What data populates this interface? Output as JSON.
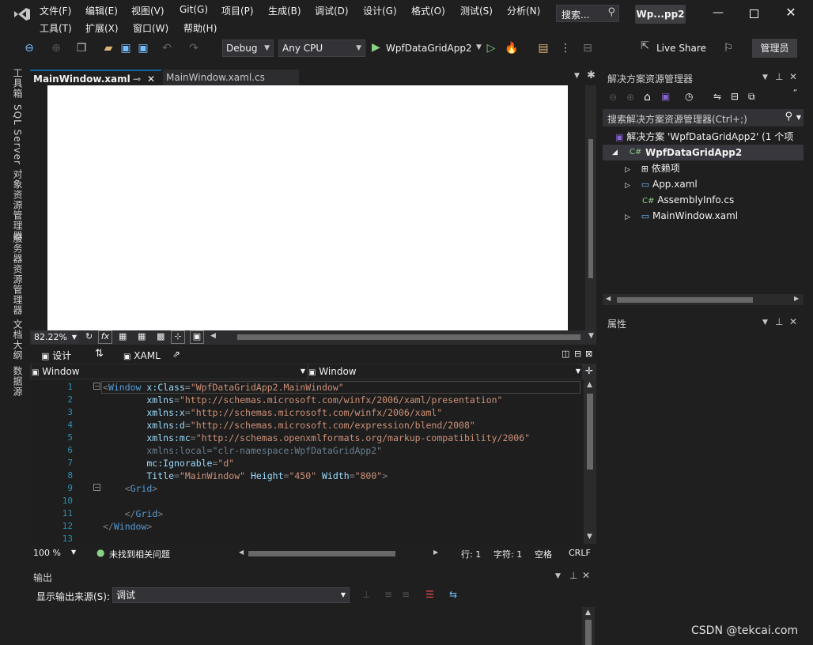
{
  "menu": {
    "row1": [
      "文件(F)",
      "编辑(E)",
      "视图(V)",
      "Git(G)",
      "项目(P)",
      "生成(B)",
      "调试(D)",
      "设计(G)",
      "格式(O)",
      "测试(S)",
      "分析(N)"
    ],
    "row2": [
      "工具(T)",
      "扩展(X)",
      "窗口(W)",
      "帮助(H)"
    ]
  },
  "search": {
    "label": "搜索..."
  },
  "app_title": "Wp...pp2",
  "toolbar": {
    "config": "Debug",
    "platform": "Any CPU",
    "start_project": "WpfDataGridApp2",
    "live_share": "Live Share",
    "admin": "管理员"
  },
  "left_strip": [
    "工具箱",
    "SQL Server 对象资源管理器",
    "服务器资源管理器",
    "文档大纲",
    "数据源"
  ],
  "tabs": {
    "active": "MainWindow.xaml",
    "inactive": "MainWindow.xaml.cs"
  },
  "designer": {
    "zoom": "82.22%",
    "fx": "fx"
  },
  "split": {
    "design": "设计",
    "xaml": "XAML"
  },
  "nav": {
    "left": "Window",
    "right": "Window"
  },
  "code": [
    {
      "n": "1",
      "parts": [
        [
          "p",
          "<"
        ],
        [
          "t",
          "Window"
        ],
        [
          "a",
          " x:Class"
        ],
        [
          "p",
          "="
        ],
        [
          "v",
          "\"WpfDataGridApp2.MainWindow\""
        ]
      ]
    },
    {
      "n": "2",
      "parts": [
        [
          "a",
          "        xmlns"
        ],
        [
          "p",
          "="
        ],
        [
          "v",
          "\"http://schemas.microsoft.com/winfx/2006/xaml/presentation\""
        ]
      ]
    },
    {
      "n": "3",
      "parts": [
        [
          "a",
          "        xmlns:x"
        ],
        [
          "p",
          "="
        ],
        [
          "v",
          "\"http://schemas.microsoft.com/winfx/2006/xaml\""
        ]
      ]
    },
    {
      "n": "4",
      "parts": [
        [
          "a",
          "        xmlns:d"
        ],
        [
          "p",
          "="
        ],
        [
          "v",
          "\"http://schemas.microsoft.com/expression/blend/2008\""
        ]
      ]
    },
    {
      "n": "5",
      "parts": [
        [
          "a",
          "        xmlns:mc"
        ],
        [
          "p",
          "="
        ],
        [
          "v",
          "\"http://schemas.openxmlformats.org/markup-compatibility/2006\""
        ]
      ]
    },
    {
      "n": "6",
      "parts": [
        [
          "g",
          "        xmlns:local=\"clr-namespace:WpfDataGridApp2\""
        ]
      ]
    },
    {
      "n": "7",
      "parts": [
        [
          "a",
          "        mc:Ignorable"
        ],
        [
          "p",
          "="
        ],
        [
          "v",
          "\"d\""
        ]
      ]
    },
    {
      "n": "8",
      "parts": [
        [
          "a",
          "        Title"
        ],
        [
          "p",
          "="
        ],
        [
          "v",
          "\"MainWindow\""
        ],
        [
          "a",
          " Height"
        ],
        [
          "p",
          "="
        ],
        [
          "v",
          "\"450\""
        ],
        [
          "a",
          " Width"
        ],
        [
          "p",
          "="
        ],
        [
          "v",
          "\"800\""
        ],
        [
          "p",
          ">"
        ]
      ]
    },
    {
      "n": "9",
      "parts": [
        [
          "p",
          "    <"
        ],
        [
          "t",
          "Grid"
        ],
        [
          "p",
          ">"
        ]
      ]
    },
    {
      "n": "10",
      "parts": []
    },
    {
      "n": "11",
      "parts": [
        [
          "p",
          "    </"
        ],
        [
          "t",
          "Grid"
        ],
        [
          "p",
          ">"
        ]
      ]
    },
    {
      "n": "12",
      "parts": [
        [
          "p",
          "</"
        ],
        [
          "t",
          "Window"
        ],
        [
          "p",
          ">"
        ]
      ]
    },
    {
      "n": "13",
      "parts": []
    }
  ],
  "editor_status": {
    "zoom": "100 %",
    "issues": "未找到相关问题",
    "line": "行: 1",
    "col": "字符: 1",
    "spaces": "空格",
    "eol": "CRLF"
  },
  "solution": {
    "title": "解决方案资源管理器",
    "search_placeholder": "搜索解决方案资源管理器(Ctrl+;)",
    "root": "解决方案 'WpfDataGridApp2' (1 个项",
    "project": "WpfDataGridApp2",
    "items": [
      "依赖项",
      "App.xaml",
      "AssemblyInfo.cs",
      "MainWindow.xaml"
    ]
  },
  "properties": {
    "title": "属性"
  },
  "output": {
    "title": "输出",
    "source_label": "显示输出来源(S):",
    "source_value": "调试"
  },
  "watermark": "CSDN @tekcai.com",
  "colors": {
    "bg": "#1f1f1f",
    "accent": "#0e639c",
    "purple": "#8a63d2"
  }
}
